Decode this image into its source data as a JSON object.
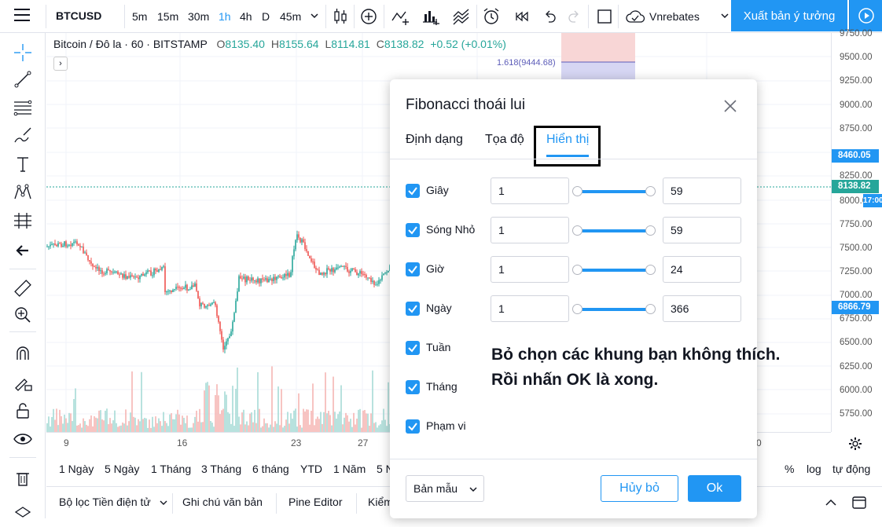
{
  "toolbar": {
    "symbol": "BTCUSD",
    "intervals": [
      "5m",
      "15m",
      "30m",
      "1h",
      "4h",
      "D",
      "45m"
    ],
    "active_interval": "1h",
    "vnrebates_label": "Vnrebates",
    "publish_label": "Xuất bản ý tưởng"
  },
  "legend": {
    "title": "Bitcoin / Đô la · 60 · BITSTAMP",
    "open_key": "O",
    "open": "8135.40",
    "high_key": "H",
    "high": "8155.64",
    "low_key": "L",
    "low": "8114.81",
    "close_key": "C",
    "close": "8138.82",
    "change": "+0.52 (+0.01%)",
    "collapse_glyph": "›"
  },
  "fib_label": "1.618(9444.68)",
  "price_axis": {
    "labels": [
      "9750.00",
      "9500.00",
      "9250.00",
      "9000.00",
      "8750.00",
      "8250.00",
      "8000.00",
      "7750.00",
      "7500.00",
      "7250.00",
      "7000.00",
      "6750.00",
      "6500.00",
      "6250.00",
      "6000.00",
      "5750.00"
    ],
    "tag_fib": "8460.05",
    "tag_price": "8138.82",
    "tag_time": "17:00",
    "tag_low": "6866.79",
    "colors": {
      "fib_tag": "#2196f3",
      "price_tag": "#26a69a",
      "time_tag": "#2196f3",
      "low_tag": "#2196f3"
    }
  },
  "time_axis": [
    "9",
    "16",
    "23",
    "27",
    "0"
  ],
  "range_bar": {
    "items": [
      "1 Ngày",
      "5 Ngày",
      "1 Tháng",
      "3 Tháng",
      "6 tháng",
      "YTD",
      "1 Năm",
      "5 N"
    ],
    "right": [
      "%",
      "log",
      "tự động"
    ]
  },
  "bottom_bar": {
    "items": [
      "Bộ lọc Tiền điện tử",
      "Ghi chú văn bản",
      "Pine Editor",
      "Kiểm"
    ]
  },
  "dialog": {
    "title": "Fibonacci thoái lui",
    "tabs": [
      "Định dạng",
      "Tọa độ",
      "Hiển thị"
    ],
    "active_tab": "Hiển thị",
    "rows": [
      {
        "label": "Giây",
        "checked": true,
        "from": "1",
        "to": "59",
        "show_inputs": true
      },
      {
        "label": "Sóng Nhỏ",
        "checked": true,
        "from": "1",
        "to": "59",
        "show_inputs": true
      },
      {
        "label": "Giờ",
        "checked": true,
        "from": "1",
        "to": "24",
        "show_inputs": true
      },
      {
        "label": "Ngày",
        "checked": true,
        "from": "1",
        "to": "366",
        "show_inputs": true
      },
      {
        "label": "Tuần",
        "checked": true,
        "show_inputs": false
      },
      {
        "label": "Tháng",
        "checked": true,
        "show_inputs": false
      },
      {
        "label": "Phạm vi",
        "checked": true,
        "show_inputs": false
      }
    ],
    "annotation_line1": "Bỏ chọn các khung bạn không thích.",
    "annotation_line2": "Rồi nhấn OK là xong.",
    "template_label": "Bản mẫu",
    "cancel_label": "Hủy bỏ",
    "ok_label": "Ok"
  }
}
